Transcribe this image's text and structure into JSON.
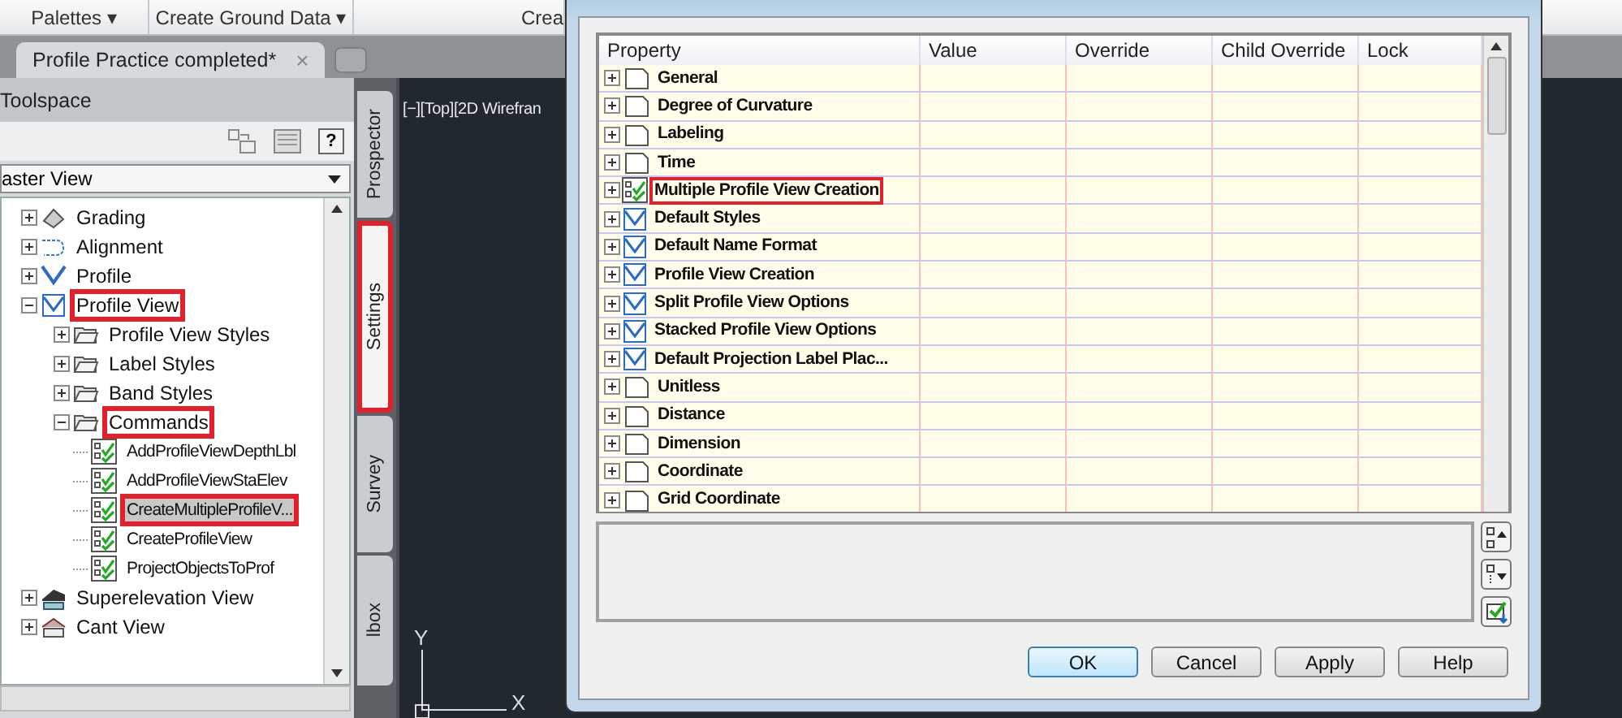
{
  "ribbon": {
    "panels": [
      {
        "label": "Palettes ▾"
      },
      {
        "label": "Create Ground Data ▾"
      },
      {
        "label": "Crea"
      }
    ]
  },
  "document_tabs": [
    {
      "label": "Profile Practice completed*",
      "selected": true,
      "close": "×"
    }
  ],
  "toolspace": {
    "title": "Toolspace",
    "help": "?",
    "view_dropdown": "aster View",
    "tree": [
      {
        "label": "Grading",
        "kind": "grading",
        "expanded": false,
        "selected": false,
        "highlighted": false
      },
      {
        "label": "Alignment",
        "kind": "alignment",
        "expanded": false,
        "selected": false,
        "highlighted": false
      },
      {
        "label": "Profile",
        "kind": "profile",
        "expanded": false,
        "selected": false,
        "highlighted": false
      },
      {
        "label": "Profile View",
        "kind": "profile-view",
        "expanded": true,
        "selected": false,
        "highlighted": true,
        "children": [
          {
            "label": "Profile View Styles",
            "kind": "folder",
            "expanded": false,
            "selected": false,
            "highlighted": false
          },
          {
            "label": "Label Styles",
            "kind": "folder",
            "expanded": false,
            "selected": false,
            "highlighted": false
          },
          {
            "label": "Band Styles",
            "kind": "folder",
            "expanded": false,
            "selected": false,
            "highlighted": false
          },
          {
            "label": "Commands",
            "kind": "folder",
            "expanded": true,
            "selected": false,
            "highlighted": true,
            "children": [
              {
                "label": "AddProfileViewDepthLbl",
                "kind": "command",
                "selected": false,
                "highlighted": false
              },
              {
                "label": "AddProfileViewStaElev",
                "kind": "command",
                "selected": false,
                "highlighted": false
              },
              {
                "label": "CreateMultipleProfileV...",
                "kind": "command",
                "selected": true,
                "highlighted": true
              },
              {
                "label": "CreateProfileView",
                "kind": "command",
                "selected": false,
                "highlighted": false
              },
              {
                "label": "ProjectObjectsToProf",
                "kind": "command",
                "selected": false,
                "highlighted": false
              }
            ]
          }
        ]
      },
      {
        "label": "Superelevation View",
        "kind": "superelevation",
        "expanded": false,
        "selected": false,
        "highlighted": false
      },
      {
        "label": "Cant View",
        "kind": "cant",
        "expanded": false,
        "selected": false,
        "highlighted": false
      }
    ]
  },
  "side_tabs": [
    {
      "label": "Prospector",
      "selected": false,
      "highlighted": false
    },
    {
      "label": "Settings",
      "selected": true,
      "highlighted": true
    },
    {
      "label": "Survey",
      "selected": false,
      "highlighted": false
    },
    {
      "label": "lbox",
      "selected": false,
      "highlighted": false
    }
  ],
  "viewport": {
    "label": "[−][Top][2D Wirefran",
    "axis_y": "Y",
    "axis_x": "X"
  },
  "dialog": {
    "columns": [
      "Property",
      "Value",
      "Override",
      "Child Override",
      "Lock"
    ],
    "rows": [
      {
        "label": "General",
        "kind": "blank",
        "highlighted": false
      },
      {
        "label": "Degree of Curvature",
        "kind": "blank",
        "highlighted": false
      },
      {
        "label": "Labeling",
        "kind": "blank",
        "highlighted": false
      },
      {
        "label": "Time",
        "kind": "blank",
        "highlighted": false
      },
      {
        "label": "Multiple Profile View Creation",
        "kind": "command",
        "highlighted": true
      },
      {
        "label": "Default Styles",
        "kind": "profile-view",
        "highlighted": false
      },
      {
        "label": "Default Name Format",
        "kind": "profile-view",
        "highlighted": false
      },
      {
        "label": "Profile View Creation",
        "kind": "profile-view",
        "highlighted": false
      },
      {
        "label": "Split Profile View Options",
        "kind": "profile-view",
        "highlighted": false
      },
      {
        "label": "Stacked Profile View Options",
        "kind": "profile-view",
        "highlighted": false
      },
      {
        "label": "Default Projection Label Plac...",
        "kind": "profile-view",
        "highlighted": false
      },
      {
        "label": "Unitless",
        "kind": "blank",
        "highlighted": false
      },
      {
        "label": "Distance",
        "kind": "blank",
        "highlighted": false
      },
      {
        "label": "Dimension",
        "kind": "blank",
        "highlighted": false
      },
      {
        "label": "Coordinate",
        "kind": "blank",
        "highlighted": false
      },
      {
        "label": "Grid Coordinate",
        "kind": "blank",
        "highlighted": false
      }
    ],
    "buttons": [
      {
        "label": "OK",
        "default": true
      },
      {
        "label": "Cancel",
        "default": false
      },
      {
        "label": "Apply",
        "default": false
      },
      {
        "label": "Help",
        "default": false
      }
    ]
  }
}
